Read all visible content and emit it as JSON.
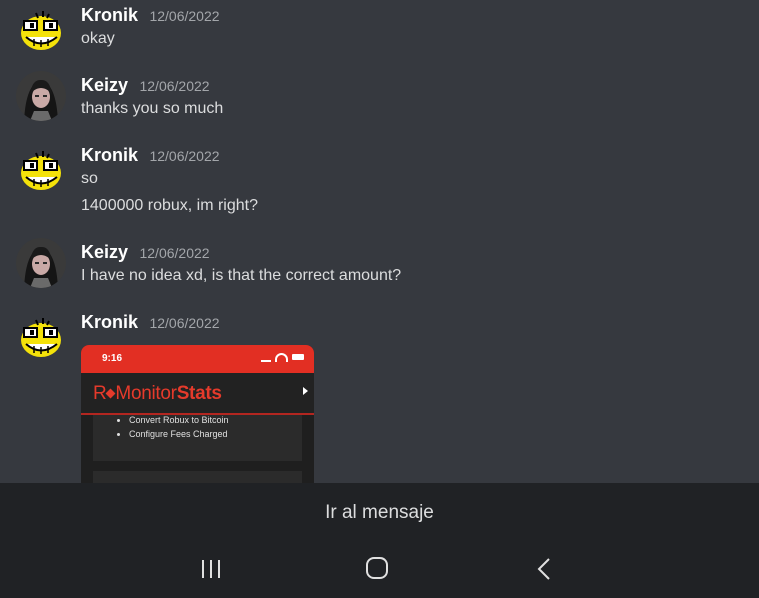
{
  "messages": [
    {
      "author": "Kronik",
      "timestamp": "12/06/2022",
      "avatar": "troll-face-avatar",
      "lines": [
        "okay"
      ]
    },
    {
      "author": "Keizy",
      "timestamp": "12/06/2022",
      "avatar": "user-photo-avatar",
      "lines": [
        "thanks you so much"
      ]
    },
    {
      "author": "Kronik",
      "timestamp": "12/06/2022",
      "avatar": "troll-face-avatar",
      "lines": [
        "so",
        "1400000 robux, im right?"
      ]
    },
    {
      "author": "Keizy",
      "timestamp": "12/06/2022",
      "avatar": "user-photo-avatar",
      "lines": [
        "I have no idea xd, is that the correct amount?"
      ]
    },
    {
      "author": "Kronik",
      "timestamp": "12/06/2022",
      "avatar": "troll-face-avatar",
      "lines": []
    }
  ],
  "attachment": {
    "status_time": "9:16",
    "logo_prefix": "R",
    "logo_brand": "Monitor",
    "logo_suffix": "Stats",
    "list_items": [
      "Convert Robux to Bitcoin",
      "Configure Fees Charged"
    ],
    "accent_color": "#e22f23"
  },
  "jump_button": {
    "label": "Ir al mensaje"
  },
  "navbar": {
    "icons": [
      "recent-apps-icon",
      "home-icon",
      "back-icon"
    ]
  },
  "colors": {
    "background": "#36393f",
    "sheet": "#202225",
    "author": "#ffffff",
    "timestamp": "#a3a6aa"
  }
}
